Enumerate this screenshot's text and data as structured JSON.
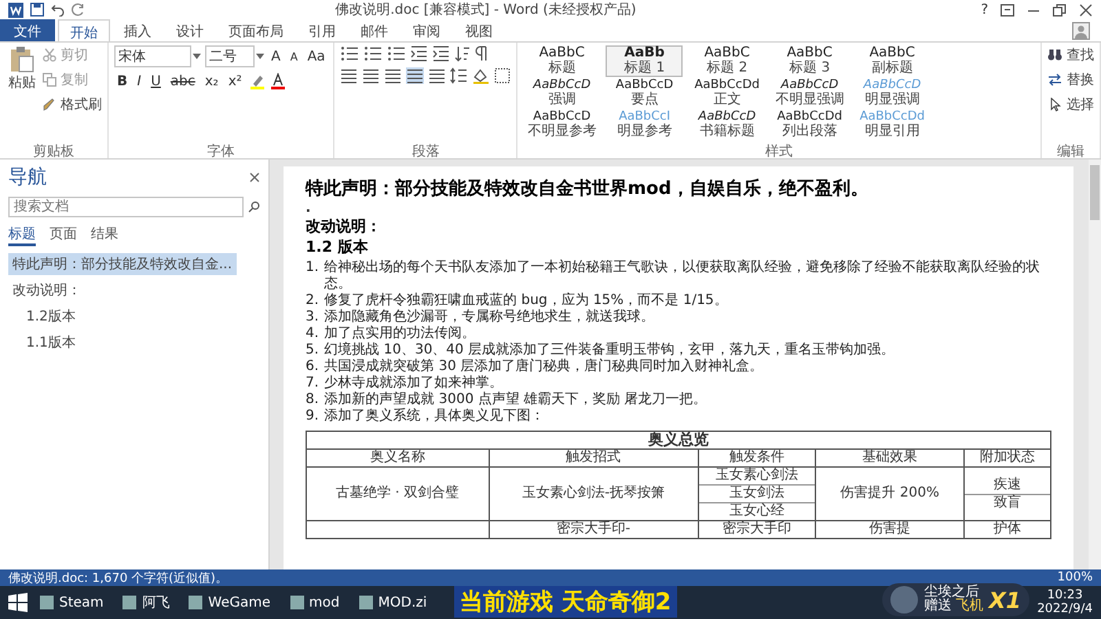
{
  "window": {
    "title": "佛改说明.doc [兼容模式] - Word (未经授权产品)",
    "help": "?"
  },
  "ribbon_tabs": [
    {
      "label": "文件",
      "kind": "file",
      "selected": false
    },
    {
      "label": "开始",
      "kind": "tab",
      "selected": true
    },
    {
      "label": "插入",
      "kind": "tab",
      "selected": false
    },
    {
      "label": "设计",
      "kind": "tab",
      "selected": false
    },
    {
      "label": "页面布局",
      "kind": "tab",
      "selected": false
    },
    {
      "label": "引用",
      "kind": "tab",
      "selected": false
    },
    {
      "label": "邮件",
      "kind": "tab",
      "selected": false
    },
    {
      "label": "审阅",
      "kind": "tab",
      "selected": false
    },
    {
      "label": "视图",
      "kind": "tab",
      "selected": false
    }
  ],
  "clipboard": {
    "paste": "粘贴",
    "cut": "剪切",
    "copy": "复制",
    "format_painter": "格式刷",
    "group_label": "剪贴板"
  },
  "font": {
    "font_name": "宋体",
    "font_size": "二号",
    "grow": "A",
    "shrink": "A",
    "case": "Aa",
    "format_buttons": [
      "B",
      "I",
      "U",
      "abc",
      "x₂",
      "x²"
    ],
    "group_label": "字体"
  },
  "paragraph": {
    "group_label": "段落"
  },
  "styles": {
    "group_label": "样式",
    "items": [
      {
        "sample": "AaBbC",
        "label": "标题",
        "selected": false
      },
      {
        "sample": "AaBb",
        "label": "标题 1",
        "selected": true
      },
      {
        "sample": "AaBbC",
        "label": "标题 2",
        "selected": false
      },
      {
        "sample": "AaBbC",
        "label": "标题 3",
        "selected": false
      },
      {
        "sample": "AaBbC",
        "label": "副标题",
        "selected": false
      },
      {
        "sample": "AaBbCcD",
        "label": "强调",
        "selected": false
      },
      {
        "sample": "AaBbCcD",
        "label": "要点",
        "selected": false
      },
      {
        "sample": "AaBbCcDd",
        "label": "正文",
        "selected": false
      },
      {
        "sample": "AaBbCcD",
        "label": "不明显强调",
        "selected": false
      },
      {
        "sample": "AaBbCcD",
        "label": "明显强调",
        "selected": false
      },
      {
        "sample": "AaBbCcD",
        "label": "不明显参考",
        "selected": false
      },
      {
        "sample": "AaBbCcI",
        "label": "明显参考",
        "selected": false
      },
      {
        "sample": "AaBbCcD",
        "label": "书籍标题",
        "selected": false
      },
      {
        "sample": "AaBbCcDd",
        "label": "列出段落",
        "selected": false
      },
      {
        "sample": "AaBbCcDd",
        "label": "明显引用",
        "selected": false
      }
    ]
  },
  "editing": {
    "find": "查找",
    "replace": "替换",
    "select": "选择",
    "group_label": "编辑"
  },
  "navigation": {
    "title": "导航",
    "search": {
      "placeholder": "搜索文档"
    },
    "tabs": [
      {
        "label": "标题",
        "selected": true
      },
      {
        "label": "页面",
        "selected": false
      },
      {
        "label": "结果",
        "selected": false
      }
    ],
    "headings": [
      {
        "label": "特此声明：部分技能及特效改自金...",
        "selected": true
      },
      {
        "label": "改动说明：",
        "selected": false,
        "children": [
          {
            "label": "1.2版本",
            "selected": false
          },
          {
            "label": "1.1版本",
            "selected": false
          }
        ]
      }
    ]
  },
  "document": {
    "title": "特此声明：部分技能及特效改自金书世界mod，自娱自乐，绝不盈利。",
    "empty_mark": ".",
    "section": "改动说明：",
    "version": "1.2 版本",
    "list": [
      {
        "number": "1.",
        "text": "给神秘出场的每个天书队友添加了一本初始秘籍王气歌诀，以便获取离队经验，避免移除了经验不能获取离队经验的状态。"
      },
      {
        "number": "2.",
        "text": "修复了虎杆令独霸狂啸血戒蓝的 bug，应为 15%，而不是 1/15。"
      },
      {
        "number": "3.",
        "text": "添加隐藏角色沙漏哥，专属称号绝地求生，就送我球。"
      },
      {
        "number": "4.",
        "text": "加了点实用的功法传阅。"
      },
      {
        "number": "5.",
        "text": "幻境挑战 10、30、40 层成就添加了三件装备重明玉带钩，玄甲，落九天，重名玉带钩加强。"
      },
      {
        "number": "6.",
        "text": "共国浸成就突破第 30 层添加了唐门秘典，唐门秘典同时加入财神礼盒。"
      },
      {
        "number": "7.",
        "text": "少林寺成就添加了如来神掌。"
      },
      {
        "number": "8.",
        "text": "添加新的声望成就 3000 点声望 雄霸天下，奖励 屠龙刀一把。"
      },
      {
        "number": "9.",
        "text": "添加了奥义系统，具体奥义见下图："
      }
    ],
    "table": {
      "caption": "奥义总览",
      "columns": [
        "奥义名称",
        "触发招式",
        "触发条件",
        "基础效果",
        "附加状态"
      ],
      "rows": [
        {
          "name": "古墓绝学 · 双剑合璧",
          "move": "玉女素心剑法-抚琴按箫",
          "conditions": [
            "玉女素心剑法",
            "玉女剑法",
            "玉女心经"
          ],
          "effect": "伤害提升 200%",
          "status": [
            "疾速",
            "致盲"
          ]
        },
        {
          "move": "密宗大手印-",
          "conditions": [
            "密宗大手印"
          ],
          "effect": "伤害提",
          "status": [
            "护体"
          ]
        }
      ]
    }
  },
  "status_bar": {
    "text": "佛改说明.doc: 1,670 个字符(近似值)。",
    "zoom": "100%"
  },
  "taskbar": {
    "items": [
      {
        "label": "Steam"
      },
      {
        "label": "阿飞"
      },
      {
        "label": "WeGame"
      },
      {
        "label": "mod"
      },
      {
        "label": "MOD.zi"
      }
    ],
    "time": "10:23",
    "date": "2022/9/4"
  },
  "stream_overlay": {
    "caption": "当前游戏 天命奇御2",
    "gift_user": "尘埃之后",
    "gift_action": "赠送",
    "gift_name": "飞机",
    "gift_count": "X1"
  }
}
